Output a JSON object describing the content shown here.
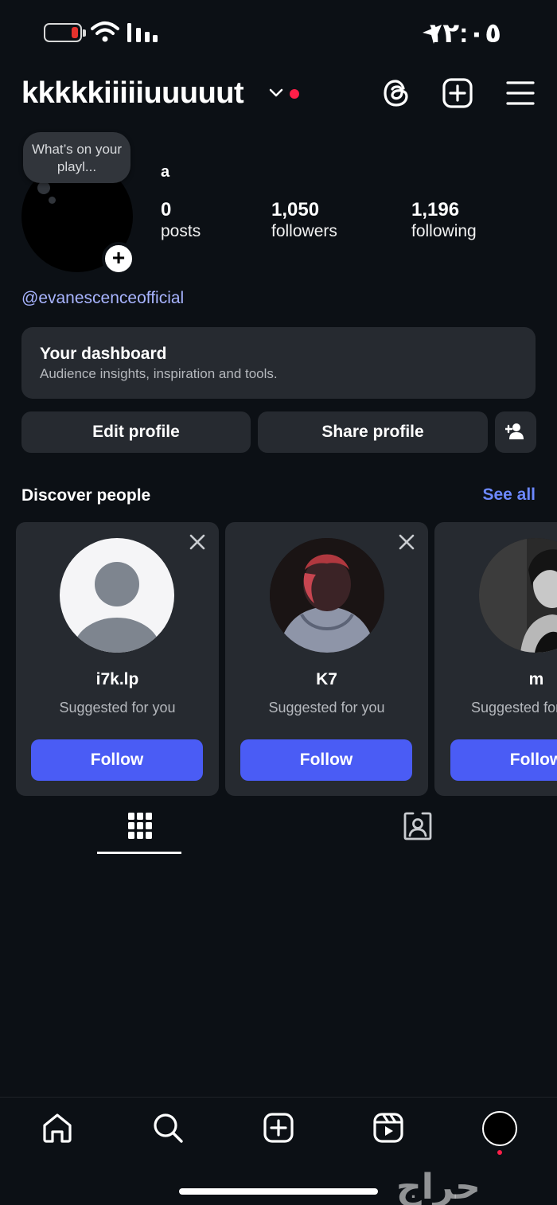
{
  "status_bar": {
    "time": "١٢:٠٥",
    "icons": [
      "battery-low-icon",
      "wifi-icon",
      "cellular-signal-icon",
      "location-arrow-icon"
    ]
  },
  "header": {
    "username": "kkkkkiiiiiuuuuut",
    "icons": [
      "chevron-down-icon",
      "threads-icon",
      "create-post-icon",
      "menu-icon"
    ],
    "live_dot_color": "#ff1f48"
  },
  "profile": {
    "note": "What’s on your playl...",
    "display_name": "a",
    "stats": [
      {
        "value": "0",
        "label": "posts"
      },
      {
        "value": "1,050",
        "label": "followers"
      },
      {
        "value": "1,196",
        "label": "following"
      }
    ],
    "bio_link": "@evanescenceofficial"
  },
  "dashboard": {
    "title": "Your dashboard",
    "subtitle": "Audience insights, inspiration and tools."
  },
  "actions": {
    "edit_label": "Edit profile",
    "share_label": "Share profile"
  },
  "discover": {
    "title": "Discover people",
    "see_all": "See all",
    "cards": [
      {
        "name": "i7k.lp",
        "subtitle": "Suggested for you",
        "follow_label": "Follow"
      },
      {
        "name": "K7",
        "subtitle": "Suggested for you",
        "follow_label": "Follow"
      },
      {
        "name": "m",
        "subtitle": "Suggested for you",
        "follow_label": "Follow"
      }
    ]
  },
  "tabs": [
    "grid-icon",
    "tagged-icon"
  ],
  "bottom_nav": [
    "home-icon",
    "search-icon",
    "create-icon",
    "reels-icon",
    "profile-avatar"
  ],
  "watermark": "حراج",
  "colors": {
    "background": "#0c1015",
    "card": "#262a30",
    "accent": "#4a5cf5",
    "link": "#a8b4ff",
    "see_all": "#6c88ff"
  }
}
